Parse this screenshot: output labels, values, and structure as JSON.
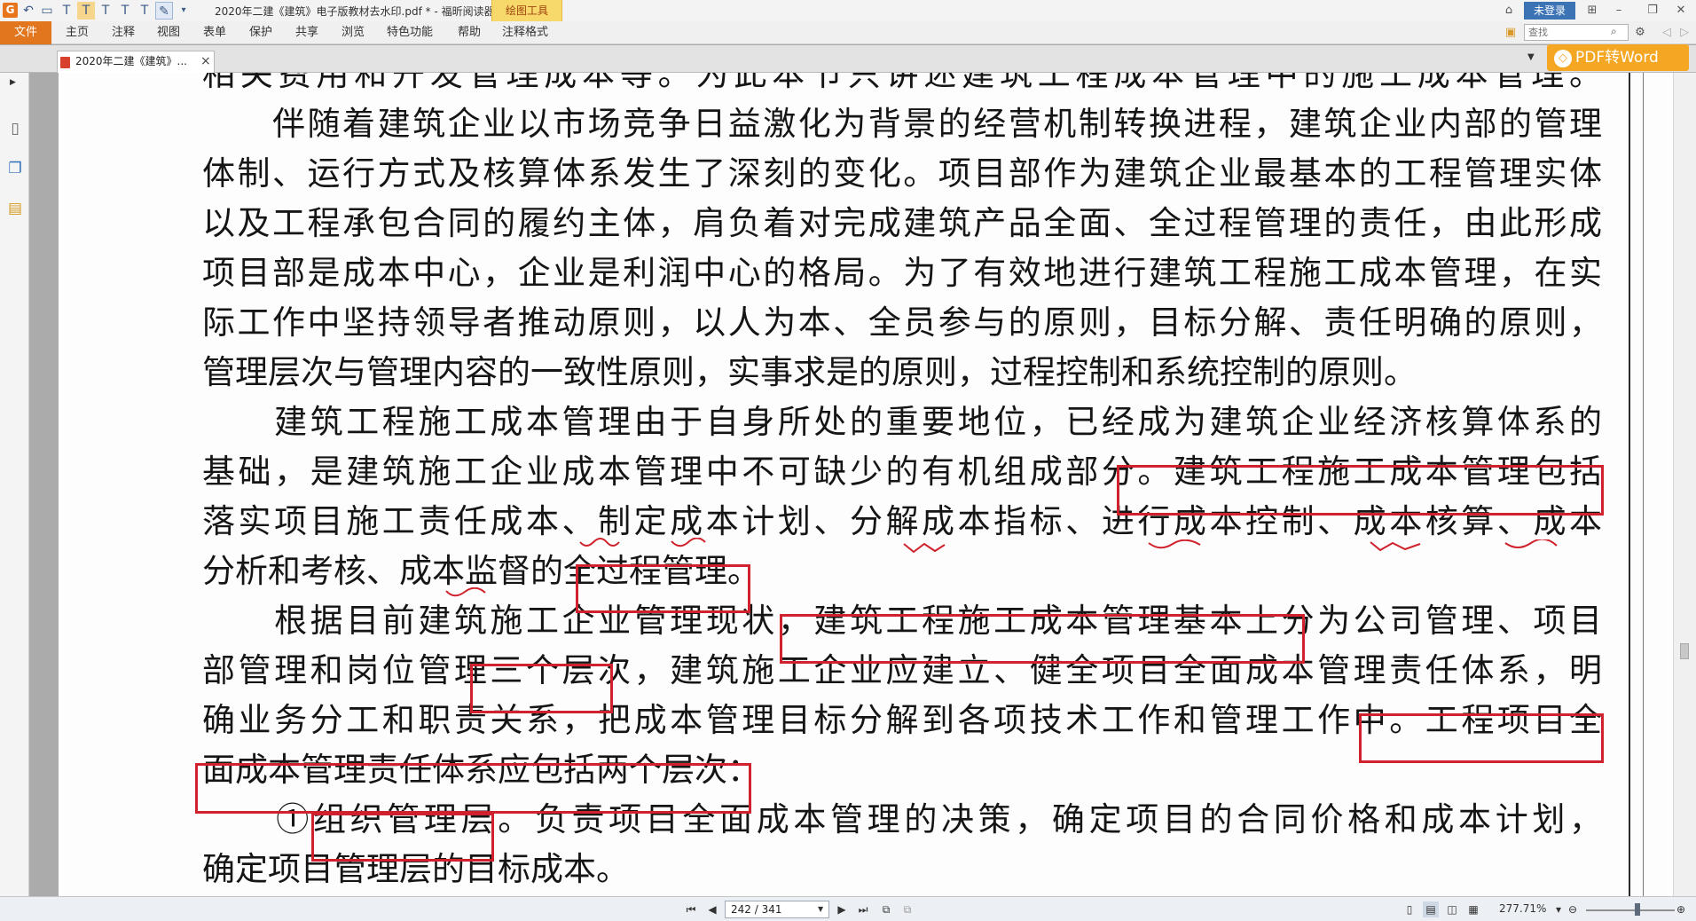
{
  "titlebar": {
    "window_title": "2020年二建《建筑》电子版教材去水印.pdf * - 福昕阅读器",
    "context_tool": "绘图工具",
    "login_label": "未登录"
  },
  "ribbon": {
    "file_label": "文件",
    "tabs": [
      "主页",
      "注释",
      "视图",
      "表单",
      "保护",
      "共享",
      "浏览",
      "特色功能",
      "帮助",
      "注释格式"
    ],
    "search_placeholder": "查找"
  },
  "tabstrip": {
    "doc_tab_title": "2020年二建《建筑》...",
    "close_label": "×",
    "pdf2word_label": "PDF转Word"
  },
  "document": {
    "lines": [
      "相关费用和开发管理成本等。为此本节只讲述建筑工程成本管理中的施工成本管理。",
      "　　伴随着建筑企业以市场竞争日益激化为背景的经营机制转换进程，建筑企业内部的管理",
      "体制、运行方式及核算体系发生了深刻的变化。项目部作为建筑企业最基本的工程管理实体",
      "以及工程承包合同的履约主体，肩负着对完成建筑产品全面、全过程管理的责任，由此形成",
      "项目部是成本中心，企业是利润中心的格局。为了有效地进行建筑工程施工成本管理，在实",
      "际工作中坚持领导者推动原则，以人为本、全员参与的原则，目标分解、责任明确的原则，",
      "管理层次与管理内容的一致性原则，实事求是的原则，过程控制和系统控制的原则。",
      "　　建筑工程施工成本管理由于自身所处的重要地位，已经成为建筑企业经济核算体系的",
      "基础，是建筑施工企业成本管理中不可缺少的有机组成部分。建筑工程施工成本管理包括",
      "落实项目施工责任成本、制定成本计划、分解成本指标、进行成本控制、成本核算、成本",
      "分析和考核、成本监督的全过程管理。",
      "　　根据目前建筑施工企业管理现状，建筑工程施工成本管理基本上分为公司管理、项目",
      "部管理和岗位管理三个层次，建筑施工企业应建立、健全项目全面成本管理责任体系，明",
      "确业务分工和职责关系，把成本管理目标分解到各项技术工作和管理工作中。工程项目全",
      "面成本管理责任体系应包括两个层次：",
      "　　①组织管理层。负责项目全面成本管理的决策，确定项目的合同价格和成本计划，",
      "确定项目管理层的目标成本。"
    ]
  },
  "statusbar": {
    "page_indicator": "242 / 341",
    "zoom": "277.71%"
  },
  "colors": {
    "accent": "#e2761e",
    "annotation_red": "#d0222c",
    "context_tab": "#f7d86b",
    "pdf2word": "#f5a623"
  },
  "icons": {
    "undo": "undo-icon",
    "search": "search-icon",
    "settings": "gear-icon"
  }
}
